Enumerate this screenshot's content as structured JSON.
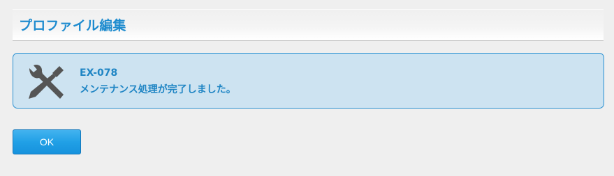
{
  "header": {
    "title": "プロファイル編集"
  },
  "message": {
    "icon": "tools-icon",
    "code": "EX-078",
    "text": "メンテナンス処理が完了しました。"
  },
  "actions": {
    "ok_label": "OK"
  },
  "colors": {
    "accent": "#1f8ccf",
    "message_background": "#cde3f1",
    "message_border": "#2a90d1",
    "button": "#21a0e6",
    "page_background": "#efefef"
  }
}
